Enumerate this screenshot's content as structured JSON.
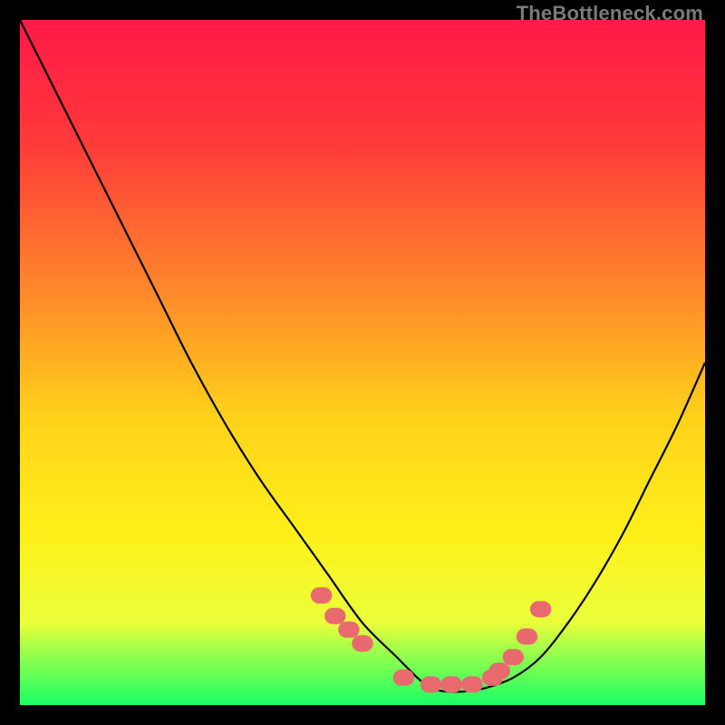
{
  "watermark": "TheBottleneck.com",
  "chart_data": {
    "type": "line",
    "title": "",
    "xlabel": "",
    "ylabel": "",
    "xlim": [
      0,
      100
    ],
    "ylim": [
      0,
      100
    ],
    "grid": false,
    "legend": false,
    "gradient_stops": [
      {
        "offset": 0.0,
        "color": "#ff1a47"
      },
      {
        "offset": 0.18,
        "color": "#ff3a3a"
      },
      {
        "offset": 0.4,
        "color": "#ff8a2a"
      },
      {
        "offset": 0.58,
        "color": "#ffd21a"
      },
      {
        "offset": 0.75,
        "color": "#fff01a"
      },
      {
        "offset": 0.88,
        "color": "#eaff3a"
      },
      {
        "offset": 0.92,
        "color": "#9fff4a"
      },
      {
        "offset": 1.0,
        "color": "#1aff66"
      }
    ],
    "series": [
      {
        "name": "bottleneck-curve",
        "x": [
          0,
          5,
          10,
          15,
          20,
          25,
          30,
          35,
          40,
          45,
          50,
          55,
          58,
          60,
          62,
          65,
          68,
          72,
          76,
          80,
          84,
          88,
          92,
          96,
          100
        ],
        "y": [
          100,
          90,
          80,
          70,
          60,
          50,
          41,
          33,
          26,
          19,
          12,
          7,
          4,
          2.5,
          2,
          2,
          2.5,
          4,
          7,
          12,
          18,
          25,
          33,
          41,
          50
        ]
      },
      {
        "name": "optimal-range-markers",
        "type": "scatter",
        "x": [
          44,
          46,
          48,
          50,
          56,
          60,
          63,
          66,
          69,
          70,
          72,
          74,
          76
        ],
        "y": [
          16,
          13,
          11,
          9,
          4,
          3,
          3,
          3,
          4,
          5,
          7,
          10,
          14
        ]
      }
    ]
  }
}
